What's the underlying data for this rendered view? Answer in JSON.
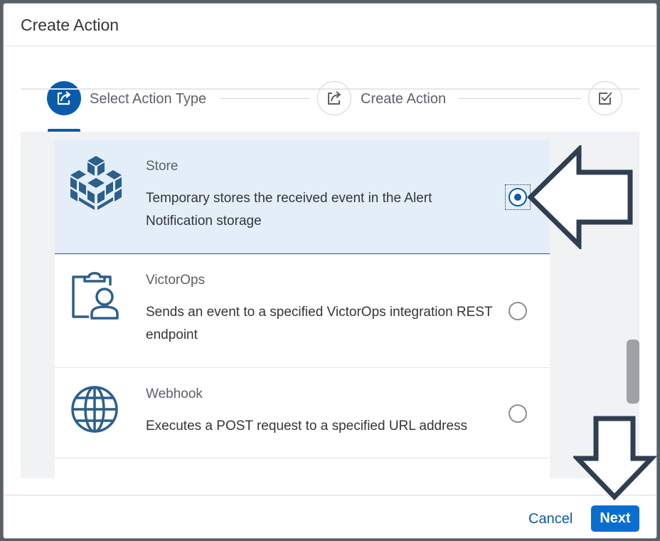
{
  "dialog": {
    "title": "Create Action"
  },
  "wizard": {
    "steps": [
      {
        "label": "Select Action Type",
        "state": "active"
      },
      {
        "label": "Create Action",
        "state": "inactive"
      },
      {
        "label": "",
        "state": "inactive"
      }
    ]
  },
  "actions": [
    {
      "name": "Store",
      "description": "Temporary stores the received event in the Alert Notification storage",
      "selected": true,
      "icon": "cube-cluster-icon"
    },
    {
      "name": "VictorOps",
      "description": "Sends an event to a specified VictorOps integration REST endpoint",
      "selected": false,
      "icon": "clipboard-user-icon"
    },
    {
      "name": "Webhook",
      "description": "Executes a POST request to a specified URL address",
      "selected": false,
      "icon": "globe-icon"
    }
  ],
  "footer": {
    "cancel_label": "Cancel",
    "next_label": "Next"
  },
  "colors": {
    "brand": "#0a5bab",
    "primary_button": "#0a6ed1",
    "selected_row": "#e4eef9",
    "annotation_arrow": "#2f3e50"
  }
}
